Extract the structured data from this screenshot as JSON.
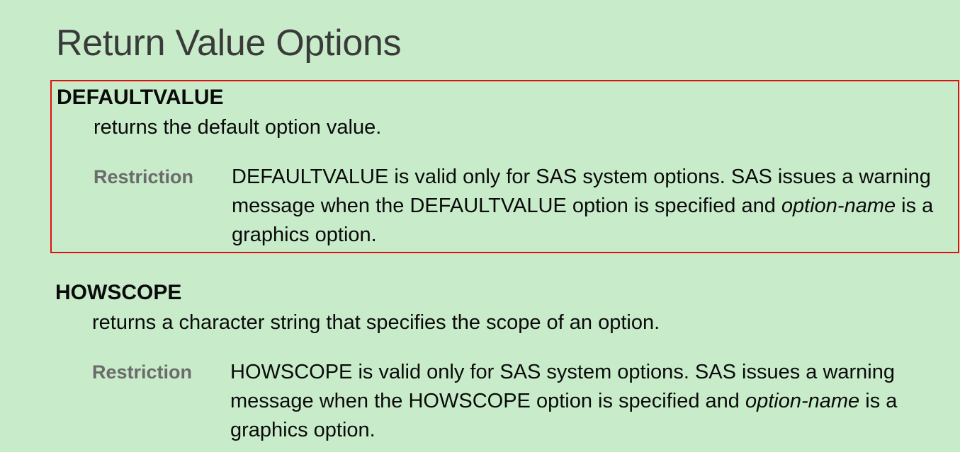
{
  "page": {
    "title": "Return Value Options"
  },
  "options": [
    {
      "term": "DEFAULTVALUE",
      "description": "returns the default option value.",
      "restriction_label": "Restriction",
      "restriction_text_before": "DEFAULTVALUE is valid only for SAS system options. SAS issues a warning message when the DEFAULTVALUE option is specified and ",
      "restriction_text_italic": "option-name",
      "restriction_text_after": " is a graphics option.",
      "highlight_color": "#e01010"
    },
    {
      "term": "HOWSCOPE",
      "description": "returns a character string that specifies the scope of an option.",
      "restriction_label": "Restriction",
      "restriction_text_before": "HOWSCOPE is valid only for SAS system options. SAS issues a warning message when the HOWSCOPE option is specified and ",
      "restriction_text_italic": "option-name",
      "restriction_text_after": " is a graphics option."
    }
  ],
  "colors": {
    "background": "#c8ecca",
    "title": "#3a3a3a",
    "restriction_label": "#6b6b6b",
    "highlight_border": "#e01010"
  }
}
